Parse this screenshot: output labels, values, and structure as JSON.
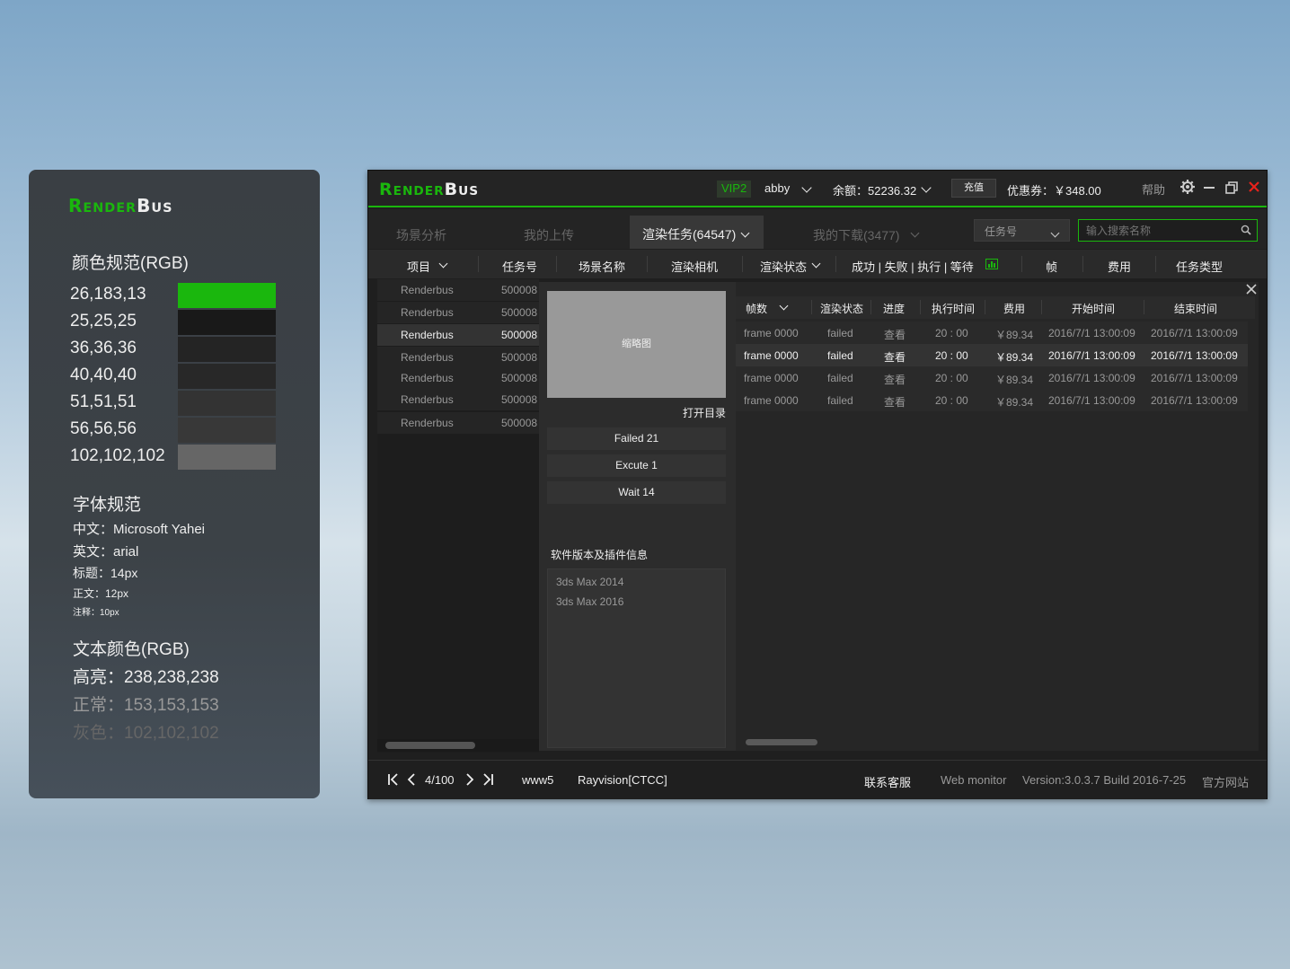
{
  "brand": {
    "part1": "Render",
    "part2": "Bus"
  },
  "colors": {
    "accent": "#1ab70d",
    "highlight": "#eeeeee",
    "normal": "#999999",
    "gray": "#666666"
  },
  "spec": {
    "color_title": "颜色规范(RGB)",
    "swatches": [
      {
        "label": "26,183,13",
        "hex": "#1ab70d"
      },
      {
        "label": "25,25,25",
        "hex": "#191919"
      },
      {
        "label": "36,36,36",
        "hex": "#242424"
      },
      {
        "label": "40,40,40",
        "hex": "#282828"
      },
      {
        "label": "51,51,51",
        "hex": "#333333"
      },
      {
        "label": "56,56,56",
        "hex": "#383838"
      },
      {
        "label": "102,102,102",
        "hex": "#666666"
      }
    ],
    "font_title": "字体规范",
    "font_cn": "中文：Microsoft Yahei",
    "font_en": "英文：arial",
    "font_heading": "标题：14px",
    "font_body": "正文：12px",
    "font_note": "注释：10px",
    "text_color_title": "文本颜色(RGB)",
    "text_highlight": "高亮：238,238,238",
    "text_normal": "正常：153,153,153",
    "text_gray": "灰色：102,102,102"
  },
  "titlebar": {
    "vip": "VIP2",
    "user": "abby",
    "balance": "余额：52236.32",
    "recharge": "充值",
    "coupon": "优惠券：￥348.00",
    "help": "帮助"
  },
  "tabs": {
    "t1": "场景分析",
    "t2": "我的上传",
    "t3": "渲染任务(64547)",
    "t4": "我的下载(3477)",
    "filter": "任务号",
    "search_placeholder": "输入搜索名称"
  },
  "columns": {
    "project": "项目",
    "task_no": "任务号",
    "scene": "场景名称",
    "camera": "渲染相机",
    "status": "渲染状态",
    "counts": "成功 | 失败 | 执行 | 等待",
    "frame": "帧",
    "cost": "费用",
    "type": "任务类型"
  },
  "tasks": [
    {
      "project": "Renderbus",
      "id": "500008"
    },
    {
      "project": "Renderbus",
      "id": "500008"
    },
    {
      "project": "Renderbus",
      "id": "500008"
    },
    {
      "project": "Renderbus",
      "id": "500008"
    },
    {
      "project": "Renderbus",
      "id": "500008"
    },
    {
      "project": "Renderbus",
      "id": "500008"
    },
    {
      "project": "Renderbus",
      "id": "500008"
    }
  ],
  "detail": {
    "thumb": "缩略图",
    "open_dir": "打开目录",
    "failed": "Failed 21",
    "execute": "Excute 1",
    "wait": "Wait 14",
    "software_title": "软件版本及插件信息",
    "software": [
      "3ds Max 2014",
      "3ds Max 2016"
    ]
  },
  "frames_header": {
    "frame": "帧数",
    "status": "渲染状态",
    "progress": "进度",
    "exec_time": "执行时间",
    "cost": "费用",
    "start": "开始时间",
    "end": "结束时间"
  },
  "frames": [
    {
      "frame": "frame 0000",
      "status": "failed",
      "progress": "查看",
      "time": "20 : 00",
      "cost": "￥89.34",
      "start": "2016/7/1 13:00:09",
      "end": "2016/7/1 13:00:09"
    },
    {
      "frame": "frame 0000",
      "status": "failed",
      "progress": "查看",
      "time": "20 : 00",
      "cost": "￥89.34",
      "start": "2016/7/1 13:00:09",
      "end": "2016/7/1 13:00:09"
    },
    {
      "frame": "frame 0000",
      "status": "failed",
      "progress": "查看",
      "time": "20 : 00",
      "cost": "￥89.34",
      "start": "2016/7/1 13:00:09",
      "end": "2016/7/1 13:00:09"
    },
    {
      "frame": "frame 0000",
      "status": "failed",
      "progress": "查看",
      "time": "20 : 00",
      "cost": "￥89.34",
      "start": "2016/7/1 13:00:09",
      "end": "2016/7/1 13:00:09"
    }
  ],
  "footer": {
    "page": "4/100",
    "server": "www5",
    "provider": "Rayvision[CTCC]",
    "support": "联系客服",
    "monitor": "Web monitor",
    "version": "Version:3.0.3.7 Build 2016-7-25",
    "site": "官方网站"
  }
}
